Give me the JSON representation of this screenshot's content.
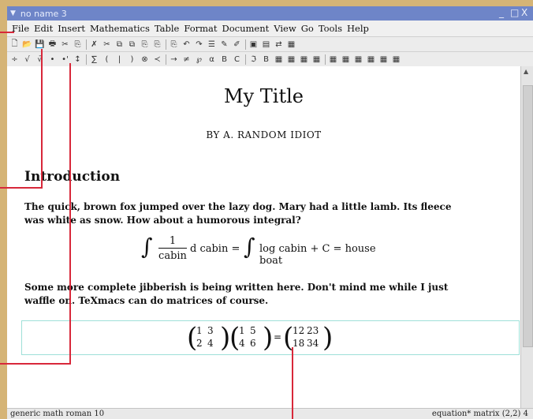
{
  "window": {
    "title": "no name 3",
    "menu_icon": "▼",
    "min": "_",
    "max": "□",
    "close": "X"
  },
  "menubar": [
    "File",
    "Edit",
    "Insert",
    "Mathematics",
    "Table",
    "Format",
    "Document",
    "View",
    "Go",
    "Tools",
    "Help"
  ],
  "toolbar1": [
    "🗋",
    "📂",
    "💾",
    "🖶",
    "✂",
    "⎘",
    "✗",
    "✂",
    "⧉",
    "⧉",
    "⎘",
    "⎘",
    "⎘",
    "↶",
    "↷",
    "☰",
    "✎",
    "✐",
    "▣",
    "▤",
    "⇄",
    "▦"
  ],
  "toolbar2": [
    "÷",
    "√",
    "√̄",
    "•",
    "•'",
    "↕",
    "∑",
    "(",
    "|",
    ")",
    "⊗",
    "≺",
    "→",
    "≠",
    "℘",
    "α",
    "B",
    "C",
    "ℑ",
    "B",
    "▦",
    "▦",
    "▦",
    "▦",
    "▦",
    "▦",
    "▦",
    "▦",
    "▦",
    "▦"
  ],
  "document": {
    "title": "My Title",
    "author": "BY A. RANDOM IDIOT",
    "section": "Introduction",
    "paragraph1_line1": "The quick, brown fox jumped over the lazy dog. Mary had a little lamb. Its fleece",
    "paragraph1_line2": "was white as snow. How about a humorous integral?",
    "formula": {
      "frac_num": "1",
      "frac_den": "cabin",
      "d_cabin": "d cabin =",
      "rhs": "log cabin + C = house boat"
    },
    "paragraph2_line1": "Some more complete jibberish is being written here. Don't mind me while I just",
    "paragraph2_line2": "waffle on. TeXmacs can do matrices of course.",
    "matrix_a": [
      [
        "1",
        "3"
      ],
      [
        "2",
        "4"
      ]
    ],
    "matrix_b": [
      [
        "1",
        "5"
      ],
      [
        "4",
        "6"
      ]
    ],
    "equals": "=",
    "matrix_c": [
      [
        "12",
        "23"
      ],
      [
        "18",
        "34"
      ]
    ]
  },
  "status": {
    "left": "generic math roman 10",
    "right": "equation* matrix (2,2) 4"
  }
}
